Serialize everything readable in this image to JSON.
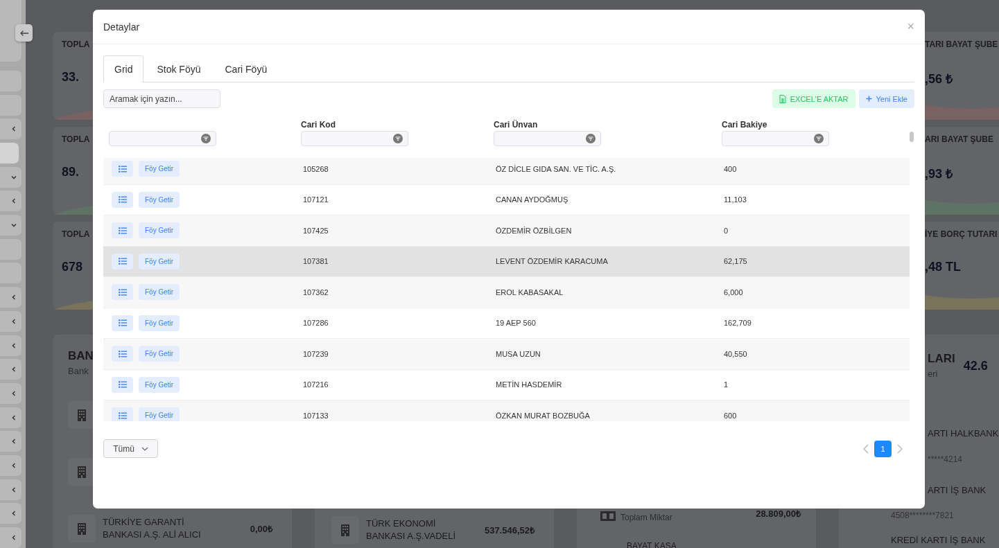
{
  "sidebar": {
    "items": [
      {
        "kind": "profile"
      },
      {
        "kind": "link",
        "selected": false
      },
      {
        "kind": "link",
        "selected": false
      },
      {
        "kind": "submenu",
        "expanded": false,
        "selected": false
      },
      {
        "kind": "link",
        "selected": true
      },
      {
        "kind": "submenu",
        "expanded": true,
        "selected": false
      },
      {
        "kind": "submenu",
        "expanded": false,
        "selected": false
      },
      {
        "kind": "submenu",
        "expanded": true,
        "selected": false
      },
      {
        "kind": "link",
        "selected": false
      },
      {
        "kind": "link",
        "selected": false
      },
      {
        "kind": "submenu",
        "expanded": false,
        "selected": false
      },
      {
        "kind": "submenu",
        "expanded": false,
        "selected": false
      },
      {
        "kind": "submenu",
        "expanded": false,
        "selected": false
      },
      {
        "kind": "submenu",
        "expanded": false,
        "selected": false
      },
      {
        "kind": "submenu",
        "expanded": false,
        "selected": false
      },
      {
        "kind": "submenu",
        "expanded": false,
        "selected": false
      },
      {
        "kind": "submenu",
        "expanded": false,
        "selected": false
      },
      {
        "kind": "submenu",
        "expanded": false,
        "selected": false
      },
      {
        "kind": "submenu",
        "expanded": false,
        "selected": false
      },
      {
        "kind": "submenu",
        "expanded": false,
        "selected": false
      },
      {
        "kind": "submenu",
        "expanded": false,
        "selected": false
      }
    ]
  },
  "stats": [
    {
      "color": "#7a6262",
      "left": {
        "title": "TOPLA",
        "value": "33."
      },
      "right": {
        "title": "TARI BAYAT ŞUBE",
        "value": ",56 ₺"
      }
    },
    {
      "color": "#5f7364",
      "left": {
        "title": "TOPLA",
        "value": "89."
      },
      "right": {
        "title": "ARI BAYAT ŞUBE",
        "value": ",93 ₺"
      }
    },
    {
      "color": "#7a735c",
      "left": {
        "title": "TOPLA",
        "value": "678"
      },
      "right": {
        "title": "İYE BORÇ TUTARI",
        "value": ",48 TL"
      }
    }
  ],
  "bank_panels": {
    "first": {
      "title": "BAN",
      "subtitle": "Bank",
      "rows": [
        {
          "kind": "covered"
        },
        {
          "kind": "covered"
        },
        {
          "kind": "entry",
          "name_lines": [
            "TÜRKİYE GARANTİ",
            "BANKASI A.Ş. ALİ ALICI"
          ],
          "amount": "0,00₺"
        }
      ]
    },
    "second": {
      "rows": [
        {
          "kind": "entry",
          "name_lines": [
            "TÜRK EKONOMİ",
            "BANKASI A.Ş.VADELİ"
          ],
          "amount": "537.546,52₺"
        }
      ]
    },
    "third": {
      "rows": [
        {
          "kind": "total",
          "subtitle": "Toplam Miktar",
          "amount": "28.809,00₺"
        },
        {
          "kind": "name",
          "name": "BAYAT KASA"
        }
      ]
    },
    "fourth": {
      "title": "LARI",
      "subtitle": "eri",
      "total": "42.6",
      "rows": [
        {
          "name": "ARTI HALKBANK",
          "detail": "*****4214",
          "below_modal": false
        },
        {
          "name": "ARTI İŞ BANK",
          "detail": "4508********7821",
          "below_modal": true
        },
        {
          "name": "KREDİ KARTI İŞ BANK",
          "below_modal": true
        }
      ]
    }
  },
  "modal": {
    "title": "Detaylar",
    "close": "×",
    "tabs": [
      {
        "label": "Grid",
        "selected": true
      },
      {
        "label": "Stok Föyü",
        "selected": false
      },
      {
        "label": "Cari Föyü",
        "selected": false
      }
    ],
    "search": {
      "placeholder": "Aramak için yazın..."
    },
    "actions": [
      {
        "kind": "excel",
        "label": "EXCEL'E AKTAR"
      },
      {
        "kind": "add",
        "label": "Yeni Ekle"
      }
    ],
    "table": {
      "columns": [
        {
          "kind": "actions"
        },
        {
          "kind": "text",
          "label": "Cari Kod"
        },
        {
          "kind": "text",
          "label": "Cari Ünvan"
        },
        {
          "kind": "text",
          "label": "Cari Bakiye"
        }
      ],
      "rows": [
        {
          "action": "Föy Getir",
          "code": "105268",
          "name": "ÖZ DİCLE GIDA SAN. VE TİC. A.Ş.",
          "balance": "400",
          "selected": false
        },
        {
          "action": "Föy Getir",
          "code": "107121",
          "name": "CANAN AYDOĞMUŞ",
          "balance": "11,103",
          "selected": false
        },
        {
          "action": "Föy Getir",
          "code": "107425",
          "name": "ÖZDEMİR ÖZBİLGEN",
          "balance": "0",
          "selected": false
        },
        {
          "action": "Föy Getir",
          "code": "107381",
          "name": "LEVENT ÖZDEMİR KARACUMA",
          "balance": "62,175",
          "selected": true
        },
        {
          "action": "Föy Getir",
          "code": "107362",
          "name": "EROL KABASAKAL",
          "balance": "6,000",
          "selected": false
        },
        {
          "action": "Föy Getir",
          "code": "107286",
          "name": "19 AEP 560",
          "balance": "162,709",
          "selected": false
        },
        {
          "action": "Föy Getir",
          "code": "107239",
          "name": "MUSA UZUN",
          "balance": "40,550",
          "selected": false
        },
        {
          "action": "Föy Getir",
          "code": "107216",
          "name": "METİN HASDEMİR",
          "balance": "1",
          "selected": false
        },
        {
          "action": "Föy Getir",
          "code": "107133",
          "name": "ÖZKAN MURAT BOZBUĞA",
          "balance": "600",
          "selected": false
        }
      ]
    },
    "page_size": "Tümü",
    "pages": [
      {
        "label": "1",
        "selected": true
      }
    ]
  }
}
